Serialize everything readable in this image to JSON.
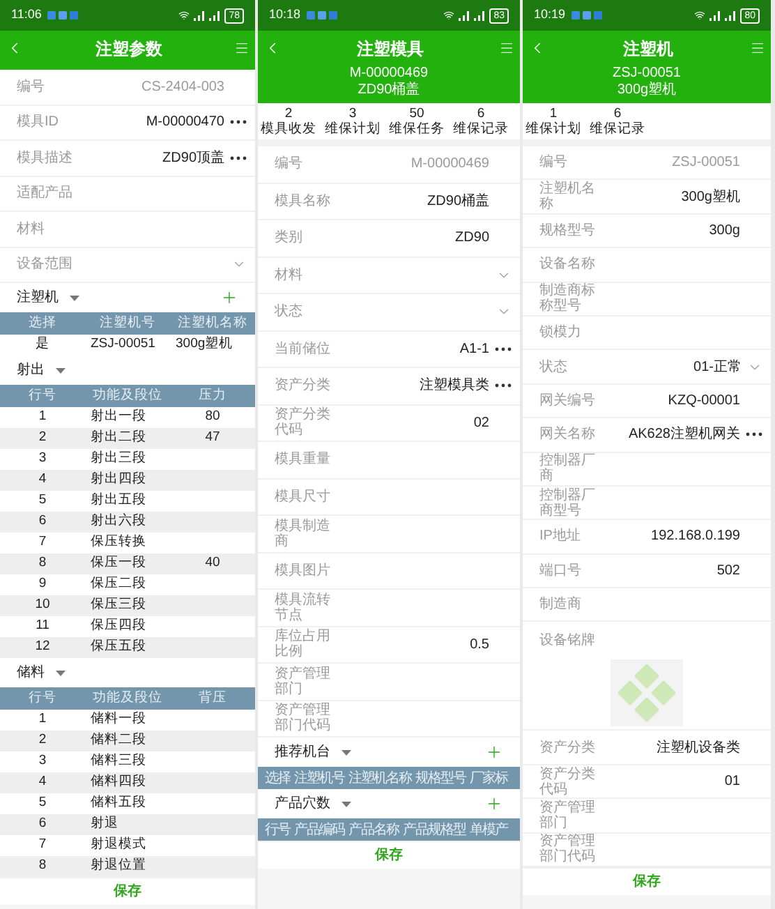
{
  "screens": [
    {
      "status_bar": {
        "time": "11:06",
        "battery": "78"
      },
      "header": {
        "title": "注塑参数"
      },
      "fields": [
        {
          "label": "编号",
          "value": "CS-2404-003",
          "kind": "readonly"
        },
        {
          "label": "模具ID",
          "value": "M-00000470",
          "kind": "lookup"
        },
        {
          "label": "模具描述",
          "value": "ZD90顶盖",
          "kind": "lookup"
        },
        {
          "label": "适配产品",
          "kind": "text"
        },
        {
          "label": "材料",
          "kind": "text"
        },
        {
          "label": "设备范围",
          "kind": "select"
        }
      ],
      "sections": [
        {
          "title": "注塑机",
          "addable": true,
          "columns": [
            "选择",
            "注塑机号",
            "注塑机名称"
          ],
          "rows": [
            [
              "是",
              "ZSJ-00051",
              "300g塑机"
            ]
          ]
        },
        {
          "title": "射出",
          "addable": false,
          "columns": [
            "行号",
            "功能及段位",
            "压力"
          ],
          "rows": [
            [
              "1",
              "射出一段",
              "80"
            ],
            [
              "2",
              "射出二段",
              "47"
            ],
            [
              "3",
              "射出三段"
            ],
            [
              "4",
              "射出四段"
            ],
            [
              "5",
              "射出五段"
            ],
            [
              "6",
              "射出六段"
            ],
            [
              "7",
              "保压转换"
            ],
            [
              "8",
              "保压一段",
              "40"
            ],
            [
              "9",
              "保压二段"
            ],
            [
              "10",
              "保压三段"
            ],
            [
              "11",
              "保压四段"
            ],
            [
              "12",
              "保压五段"
            ]
          ]
        },
        {
          "title": "储料",
          "addable": false,
          "columns": [
            "行号",
            "功能及段位",
            "背压"
          ],
          "rows": [
            [
              "1",
              "储料一段"
            ],
            [
              "2",
              "储料二段"
            ],
            [
              "3",
              "储料三段"
            ],
            [
              "4",
              "储料四段"
            ],
            [
              "5",
              "储料五段"
            ],
            [
              "6",
              "射退"
            ],
            [
              "7",
              "射退模式"
            ],
            [
              "8",
              "射退位置"
            ]
          ]
        }
      ],
      "save": "保存"
    },
    {
      "status_bar": {
        "time": "10:18",
        "battery": "83"
      },
      "header": {
        "title": "注塑模具",
        "lines": [
          "M-00000469",
          "ZD90桶盖"
        ]
      },
      "counters": [
        {
          "count": "2",
          "label": "模具收发"
        },
        {
          "count": "3",
          "label": "维保计划"
        },
        {
          "count": "50",
          "label": "维保任务"
        },
        {
          "count": "6",
          "label": "维保记录"
        }
      ],
      "fields": [
        {
          "label": "编号",
          "value": "M-00000469",
          "kind": "readonly"
        },
        {
          "label": "模具名称",
          "value": "ZD90桶盖",
          "kind": "text"
        },
        {
          "label": "类别",
          "value": "ZD90",
          "kind": "text"
        },
        {
          "label": "材料",
          "kind": "select"
        },
        {
          "label": "状态",
          "kind": "select"
        },
        {
          "label": "当前储位",
          "value": "A1-1",
          "kind": "lookup"
        },
        {
          "label": "资产分类",
          "value": "注塑模具类",
          "kind": "lookup"
        },
        {
          "label": "资产分类代码",
          "value": "02",
          "kind": "text"
        },
        {
          "label": "模具重量",
          "kind": "text"
        },
        {
          "label": "模具尺寸",
          "kind": "text"
        },
        {
          "label": "模具制造商",
          "kind": "text"
        },
        {
          "label": "模具图片",
          "kind": "text"
        },
        {
          "label": "模具流转节点",
          "kind": "text"
        },
        {
          "label": "库位占用比例",
          "value": "0.5",
          "kind": "text"
        },
        {
          "label": "资产管理部门",
          "kind": "text"
        },
        {
          "label": "资产管理部门代码",
          "kind": "text"
        }
      ],
      "sections": [
        {
          "title": "推荐机台",
          "addable": true,
          "columns": [
            "选择",
            "注塑机号",
            "注塑机名称",
            "规格型号",
            "厂家标"
          ]
        },
        {
          "title": "产品穴数",
          "addable": true,
          "columns": [
            "行号",
            "产品编码",
            "产品名称",
            "产品规格型",
            "单模产"
          ]
        }
      ],
      "save": "保存"
    },
    {
      "status_bar": {
        "time": "10:19",
        "battery": "80"
      },
      "header": {
        "title": "注塑机",
        "lines": [
          "ZSJ-00051",
          "300g塑机"
        ]
      },
      "counters": [
        {
          "count": "1",
          "label": "维保计划"
        },
        {
          "count": "6",
          "label": "维保记录"
        }
      ],
      "fields": [
        {
          "label": "编号",
          "value": "ZSJ-00051",
          "kind": "readonly"
        },
        {
          "label": "注塑机名称",
          "value": "300g塑机",
          "kind": "text"
        },
        {
          "label": "规格型号",
          "value": "300g",
          "kind": "text"
        },
        {
          "label": "设备名称",
          "kind": "text"
        },
        {
          "label": "制造商标称型号",
          "kind": "text"
        },
        {
          "label": "锁模力",
          "kind": "text"
        },
        {
          "label": "状态",
          "value": "01-正常",
          "kind": "select"
        },
        {
          "label": "网关编号",
          "value": "KZQ-00001",
          "kind": "text"
        },
        {
          "label": "网关名称",
          "value": "AK628注塑机网关",
          "kind": "lookup"
        },
        {
          "label": "控制器厂商",
          "kind": "text"
        },
        {
          "label": "控制器厂商型号",
          "kind": "text"
        },
        {
          "label": "IP地址",
          "value": "192.168.0.199",
          "kind": "text"
        },
        {
          "label": "端口号",
          "value": "502",
          "kind": "text"
        },
        {
          "label": "制造商",
          "kind": "text"
        },
        {
          "label": "设备铭牌",
          "kind": "image"
        },
        {
          "label": "资产分类",
          "value": "注塑机设备类",
          "kind": "text"
        },
        {
          "label": "资产分类代码",
          "value": "01",
          "kind": "text"
        },
        {
          "label": "资产管理部门",
          "kind": "text"
        },
        {
          "label": "资产管理部门代码",
          "kind": "text"
        }
      ],
      "save": "保存"
    }
  ]
}
